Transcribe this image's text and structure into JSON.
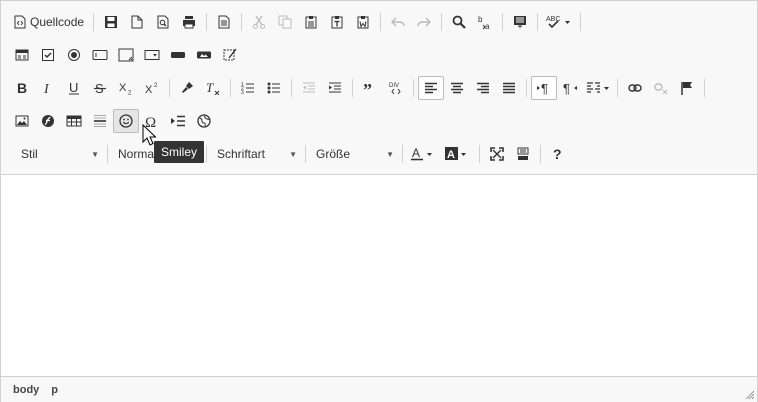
{
  "toolbar": {
    "source_label": "Quellcode",
    "style_label": "Stil",
    "format_label": "Normal",
    "font_label": "Schriftart",
    "size_label": "Größe"
  },
  "tooltip": {
    "text": "Smiley"
  },
  "status": {
    "path": [
      "body",
      "p"
    ]
  },
  "colors": {
    "toolbar_bg": "#f8f8f8",
    "border": "#d1d1d1",
    "tooltip_bg": "#333333",
    "icon": "#333333"
  }
}
